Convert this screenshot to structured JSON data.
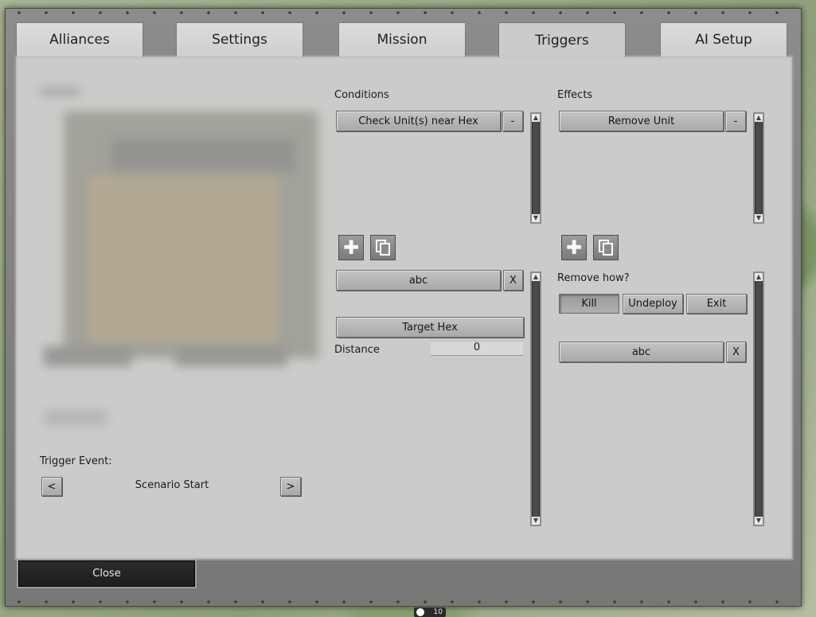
{
  "tabs": [
    {
      "label": "Alliances",
      "active": false
    },
    {
      "label": "Settings",
      "active": false
    },
    {
      "label": "Mission",
      "active": false
    },
    {
      "label": "Triggers",
      "active": true
    },
    {
      "label": "AI Setup",
      "active": false
    }
  ],
  "left": {
    "trigger_event_label": "Trigger Event:",
    "prev_label": "<",
    "next_label": ">",
    "trigger_event_value": "Scenario Start"
  },
  "conditions": {
    "header": "Conditions",
    "item": "Check Unit(s) near Hex",
    "remove_label": "-",
    "add_icon": "plus-icon",
    "copy_icon": "copy-icon",
    "name_value": "abc",
    "clear_label": "X",
    "target_button": "Target Hex",
    "distance_label": "Distance",
    "distance_value": "0"
  },
  "effects": {
    "header": "Effects",
    "item": "Remove Unit",
    "remove_label": "-",
    "add_icon": "plus-icon",
    "copy_icon": "copy-icon",
    "remove_how_label": "Remove how?",
    "options": [
      "Kill",
      "Undeploy",
      "Exit"
    ],
    "selected_option": "Kill",
    "name_value": "abc",
    "clear_label": "X"
  },
  "footer": {
    "close_label": "Close"
  },
  "map_badge": "10",
  "colors": {
    "panel": "#cbcbc9",
    "frame": "#828280",
    "button": "#b8b8b6",
    "close_button": "#222222"
  }
}
